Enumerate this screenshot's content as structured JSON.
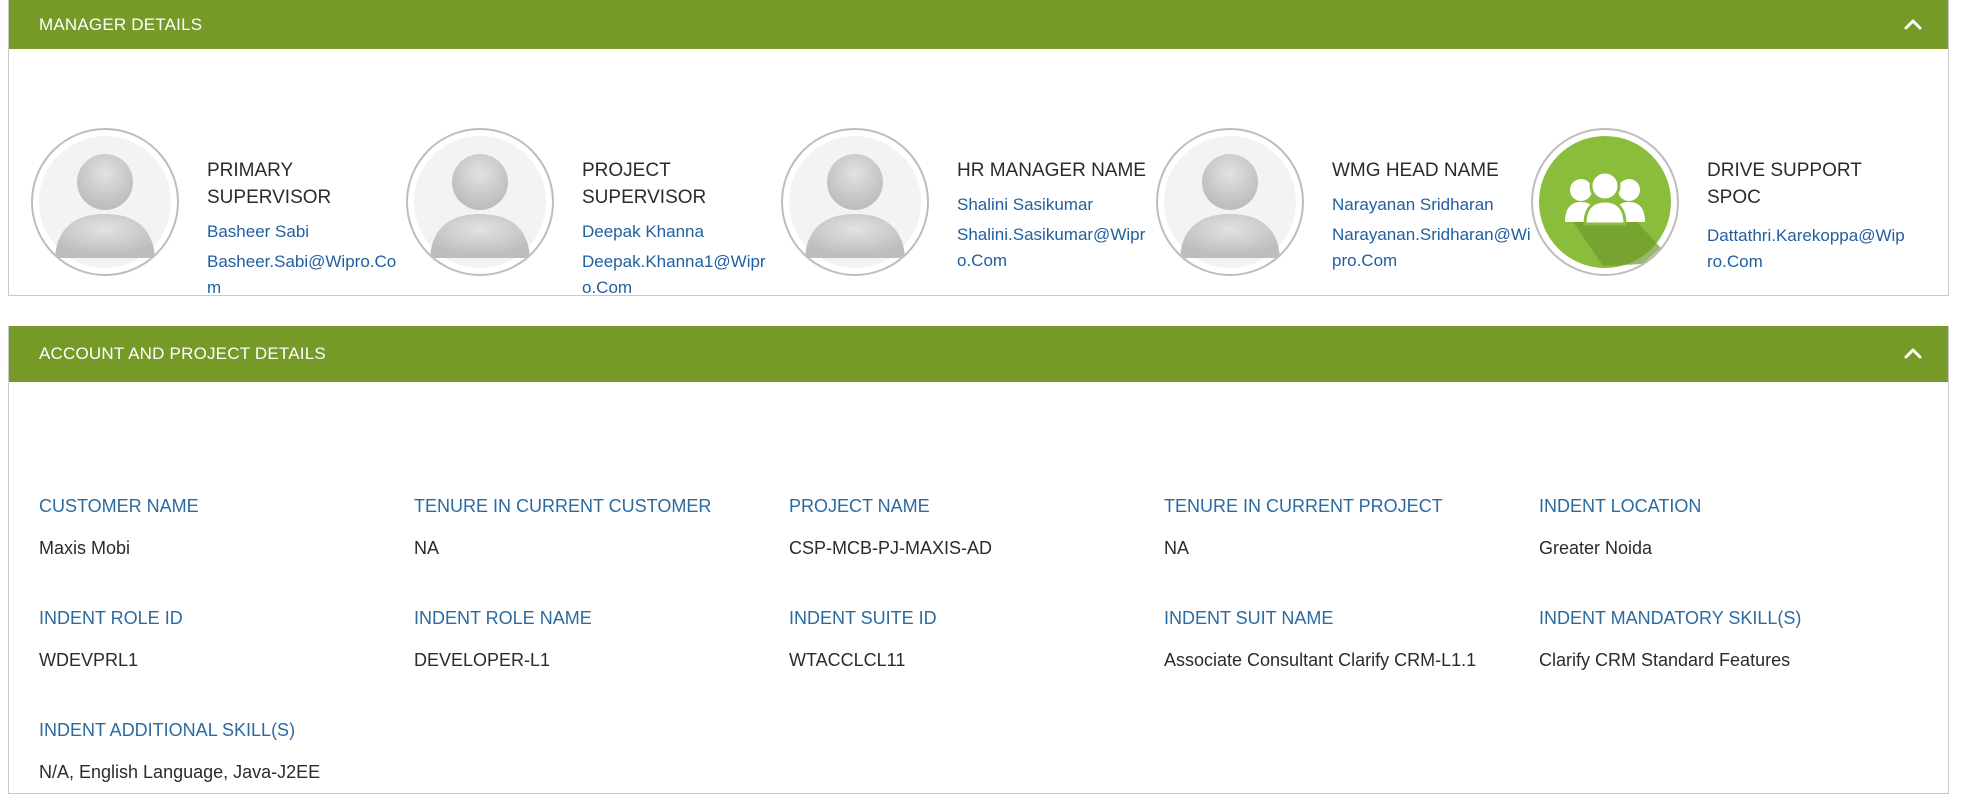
{
  "manager_panel": {
    "title": "MANAGER DETAILS",
    "collapse_icon": "chevron-up-icon",
    "cards": [
      {
        "role": "PRIMARY SUPERVISOR",
        "name": "Basheer Sabi",
        "email": "Basheer.Sabi@Wipro.Com",
        "avatar": "default-user-avatar"
      },
      {
        "role": "PROJECT SUPERVISOR",
        "name": "Deepak Khanna",
        "email": "Deepak.Khanna1@Wipro.Com",
        "avatar": "default-user-avatar"
      },
      {
        "role": "HR MANAGER NAME",
        "name": "Shalini Sasikumar",
        "email": "Shalini.Sasikumar@Wipro.Com",
        "avatar": "default-user-avatar"
      },
      {
        "role": "WMG HEAD NAME",
        "name": "Narayanan Sridharan",
        "email": "Narayanan.Sridharan@Wipro.Com",
        "avatar": "default-user-avatar"
      },
      {
        "role": "DRIVE SUPPORT SPOC",
        "name": "",
        "email": "Dattathri.Karekoppa@Wipro.Com",
        "avatar": "group-icon"
      }
    ]
  },
  "account_panel": {
    "title": "ACCOUNT AND PROJECT DETAILS",
    "collapse_icon": "chevron-up-icon",
    "fields": [
      {
        "label": "CUSTOMER NAME",
        "value": "Maxis Mobi"
      },
      {
        "label": "TENURE IN CURRENT CUSTOMER",
        "value": "NA"
      },
      {
        "label": "PROJECT NAME",
        "value": "CSP-MCB-PJ-MAXIS-AD"
      },
      {
        "label": "TENURE IN CURRENT PROJECT",
        "value": "NA"
      },
      {
        "label": "INDENT LOCATION",
        "value": "Greater Noida"
      },
      {
        "label": "INDENT ROLE ID",
        "value": "WDEVPRL1"
      },
      {
        "label": "INDENT ROLE NAME",
        "value": "DEVELOPER-L1"
      },
      {
        "label": "INDENT SUITE ID",
        "value": "WTACCLCL11"
      },
      {
        "label": "INDENT SUIT NAME",
        "value": "Associate Consultant Clarify CRM-L1.1"
      },
      {
        "label": "INDENT MANDATORY SKILL(S)",
        "value": "Clarify CRM Standard Features"
      },
      {
        "label": "INDENT ADDITIONAL SKILL(S)",
        "value": "N/A, English Language, Java-J2EE"
      }
    ]
  },
  "colors": {
    "header_green": "#759a28",
    "link_blue": "#2060a0",
    "label_blue": "#2c6aa0",
    "group_icon_green": "#8bbd3c"
  }
}
